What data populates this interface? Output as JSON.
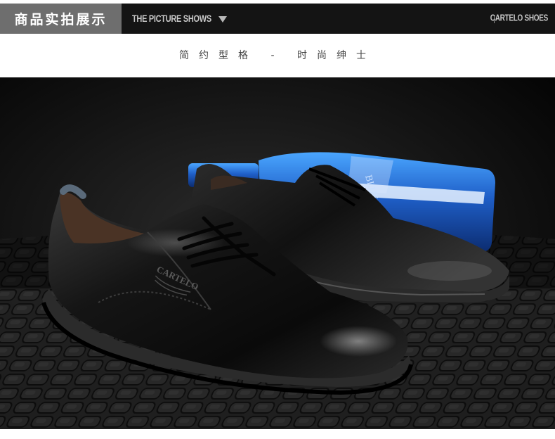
{
  "header": {
    "section_title": "商品实拍展示",
    "section_subtitle": "THE PICTURE SHOWS",
    "brand": "CARTELO SHOES"
  },
  "tagline": "简约型格 - 时尚绅士",
  "photo": {
    "embossed_logo_text": "CARTELO",
    "bottle_label_text": "BLUE"
  },
  "colors": {
    "header_bg": "#141414",
    "label_bg": "#6e6e6e",
    "bottle_blue": "#2f7de8"
  }
}
